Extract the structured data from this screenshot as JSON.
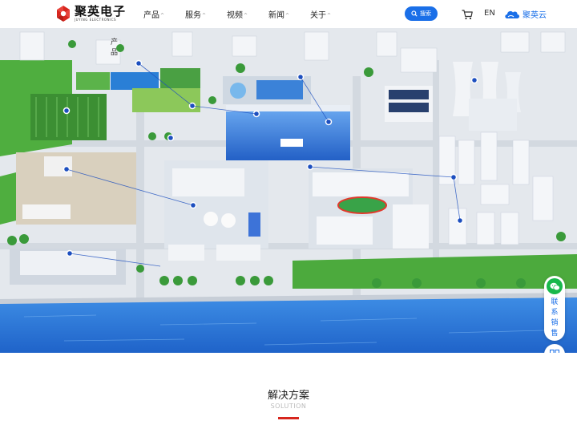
{
  "header": {
    "logo": {
      "cn": "聚英电子",
      "en": "JUYING ELECTRONICS"
    },
    "nav": [
      {
        "label": "产品"
      },
      {
        "label": "服务"
      },
      {
        "label": "视频"
      },
      {
        "label": "新闻"
      },
      {
        "label": "关于"
      }
    ],
    "search_label": "搜索",
    "lang_label": "EN",
    "cloud_label": "聚英云"
  },
  "float": {
    "contact_label": "联系销售"
  },
  "section": {
    "title": "解决方案",
    "subtitle": "SOLUTION"
  },
  "icons": {
    "logo": "juying-logo-icon",
    "search": "search-icon",
    "cart": "cart-icon",
    "cloud": "cloud-icon",
    "wechat": "wechat-icon",
    "qrcode": "qrcode-icon",
    "phone": "phone-icon"
  },
  "colors": {
    "accent": "#1a6fe8",
    "brand_red": "#d7261e",
    "wechat_green": "#18b84b"
  }
}
